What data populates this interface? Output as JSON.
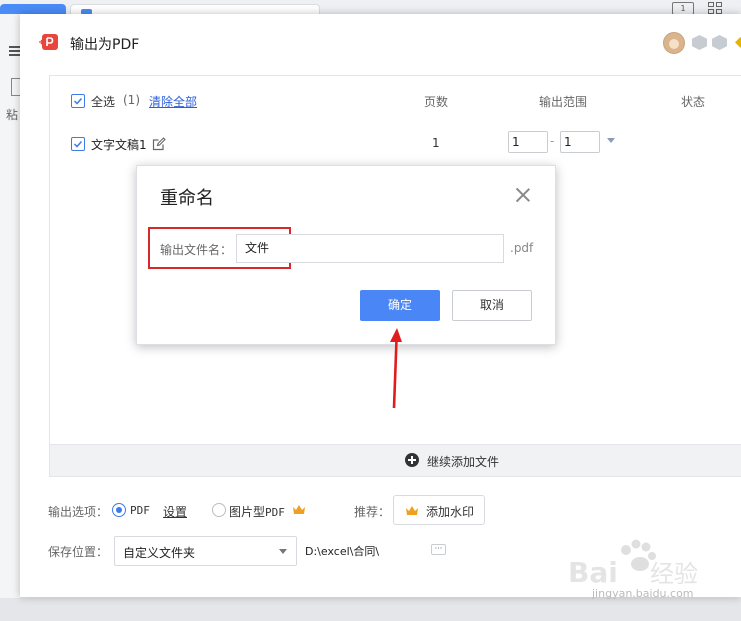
{
  "dialog": {
    "title": "输出为PDF"
  },
  "file_list": {
    "select_all_label": "全选",
    "selected_count": "(1)",
    "clear_all_label": "清除全部",
    "columns": {
      "pages": "页数",
      "range": "输出范围",
      "status": "状态"
    },
    "rows": [
      {
        "name": "文字文稿1",
        "pages": "1",
        "range_from": "1",
        "range_to": "1",
        "checked": true
      }
    ],
    "range_separator": "-",
    "add_more_label": "继续添加文件"
  },
  "output_options": {
    "label": "输出选项：",
    "pdf_label": "PDF",
    "settings_label": "设置",
    "image_pdf_label_prefix": "图片型",
    "image_pdf_label_suffix": "PDF",
    "recommend_label": "推荐：",
    "watermark_button": "添加水印",
    "selected": "PDF"
  },
  "save": {
    "label": "保存位置：",
    "location_value": "自定义文件夹",
    "path": "D:\\excel\\合同\\",
    "more_button": "···"
  },
  "rename_modal": {
    "title": "重命名",
    "field_label": "输出文件名：",
    "field_value": "文件",
    "extension": ".pdf",
    "ok_label": "确定",
    "cancel_label": "取消"
  },
  "background": {
    "paste_label": "粘"
  },
  "colors": {
    "accent": "#4a86f5",
    "highlight": "#d42a2a",
    "link": "#2b5fd9",
    "crown": "#f0a020"
  },
  "watermark_text": "jingyan.baidu.com"
}
